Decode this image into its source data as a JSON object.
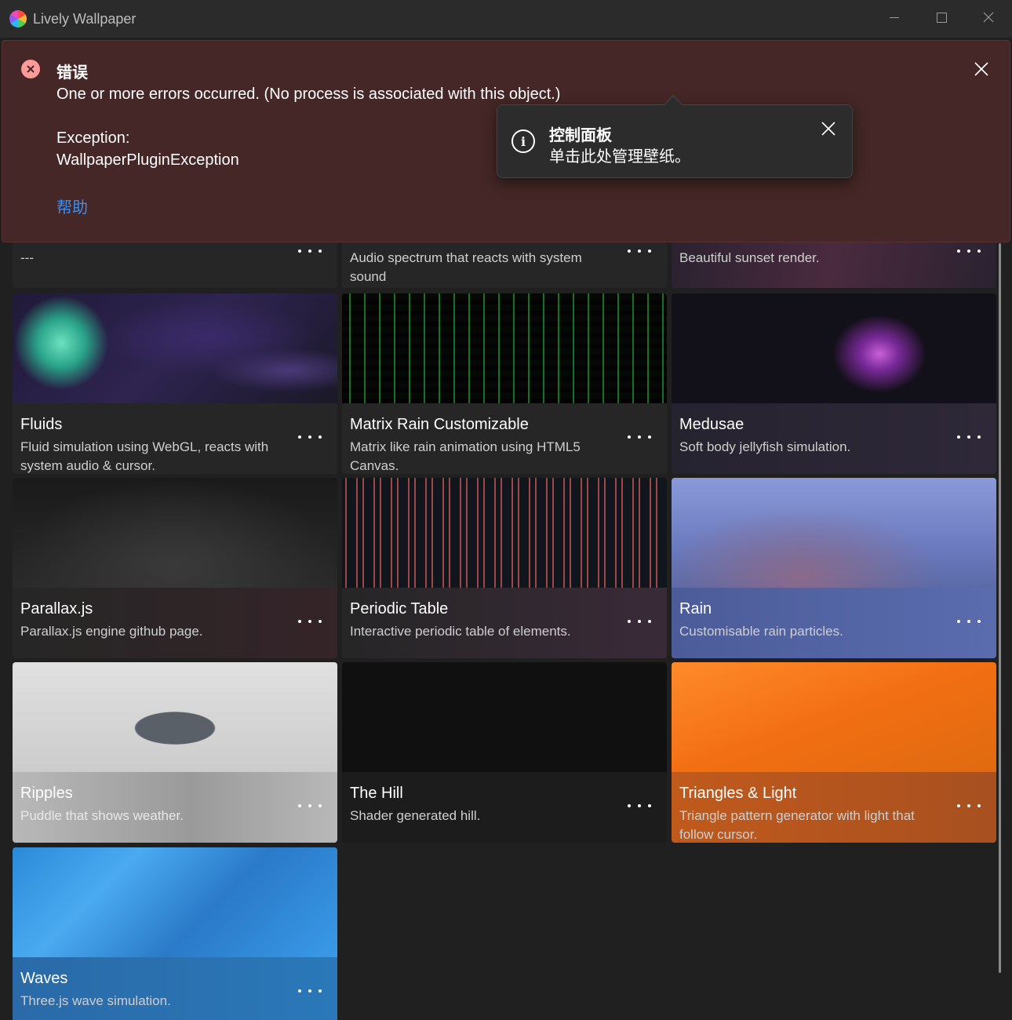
{
  "window": {
    "title": "Lively Wallpaper"
  },
  "error": {
    "title": "错误",
    "message": "One or more errors occurred. (No process is associated with this object.)",
    "exception_label": "Exception:",
    "exception_name": "WallpaperPluginException",
    "help_link": "帮助"
  },
  "tip": {
    "title": "控制面板",
    "subtitle": "单击此处管理壁纸。"
  },
  "partial_cards": [
    {
      "desc": "---"
    },
    {
      "desc": "Audio spectrum that reacts with system sound"
    },
    {
      "desc": "Beautiful sunset render."
    }
  ],
  "cards": [
    {
      "title": "Fluids",
      "desc": "Fluid simulation using WebGL, reacts with system audio & cursor."
    },
    {
      "title": "Matrix Rain Customizable",
      "desc": "Matrix like rain animation using HTML5 Canvas."
    },
    {
      "title": "Medusae",
      "desc": "Soft body jellyfish simulation."
    },
    {
      "title": "Parallax.js",
      "desc": "Parallax.js engine github page."
    },
    {
      "title": "Periodic Table",
      "desc": "Interactive periodic table of elements."
    },
    {
      "title": "Rain",
      "desc": "Customisable rain particles."
    },
    {
      "title": "Ripples",
      "desc": "Puddle that shows weather."
    },
    {
      "title": "The Hill",
      "desc": "Shader generated hill."
    },
    {
      "title": "Triangles & Light",
      "desc": "Triangle pattern generator with light that follow cursor."
    },
    {
      "title": "Waves",
      "desc": "Three.js wave simulation."
    }
  ],
  "colors": {
    "error_bg": "#442726",
    "link": "#3e8ef0",
    "app_bg": "#202020"
  }
}
